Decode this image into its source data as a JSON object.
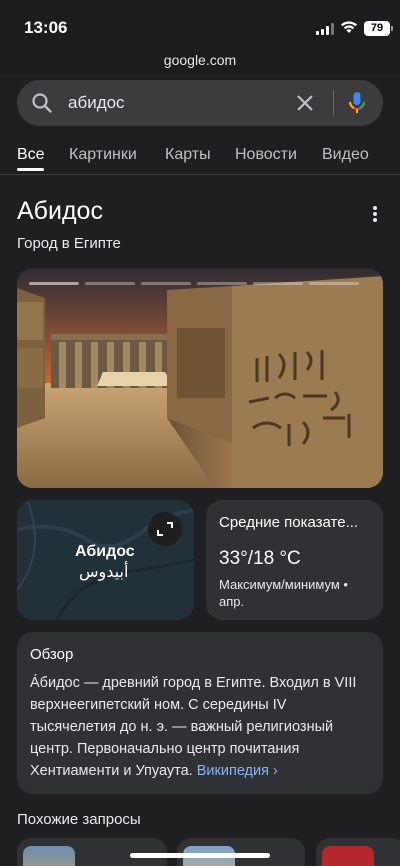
{
  "status": {
    "time": "13:06",
    "battery": "79"
  },
  "url": "google.com",
  "search": {
    "query": "абидос"
  },
  "tabs": [
    "Все",
    "Картинки",
    "Карты",
    "Новости",
    "Видео"
  ],
  "entity": {
    "title": "Абидос",
    "subtitle": "Город в Египте"
  },
  "map": {
    "label": "Абидос",
    "label_ar": "أبيدوس"
  },
  "weather": {
    "title": "Средние показате...",
    "temp": "33°/18 °C",
    "note": "Максимум/минимум • апр."
  },
  "overview": {
    "heading": "Обзор",
    "text": "А́бидос — древний город в Египте. Входил в VIII верхнеегипетский ном. С середины IV тысячелетия до н. э. — важный религиозный центр. Первоначально центр почитания Хентиаменти и Упуаута.",
    "link": "Википедия ›"
  },
  "related": {
    "heading": "Похожие запросы"
  },
  "colors": {
    "accent_link": "#8ab4f8",
    "background": "#1f1f21",
    "card": "#303134",
    "mic_blue": "#4285f4",
    "mic_red": "#ea4335"
  }
}
